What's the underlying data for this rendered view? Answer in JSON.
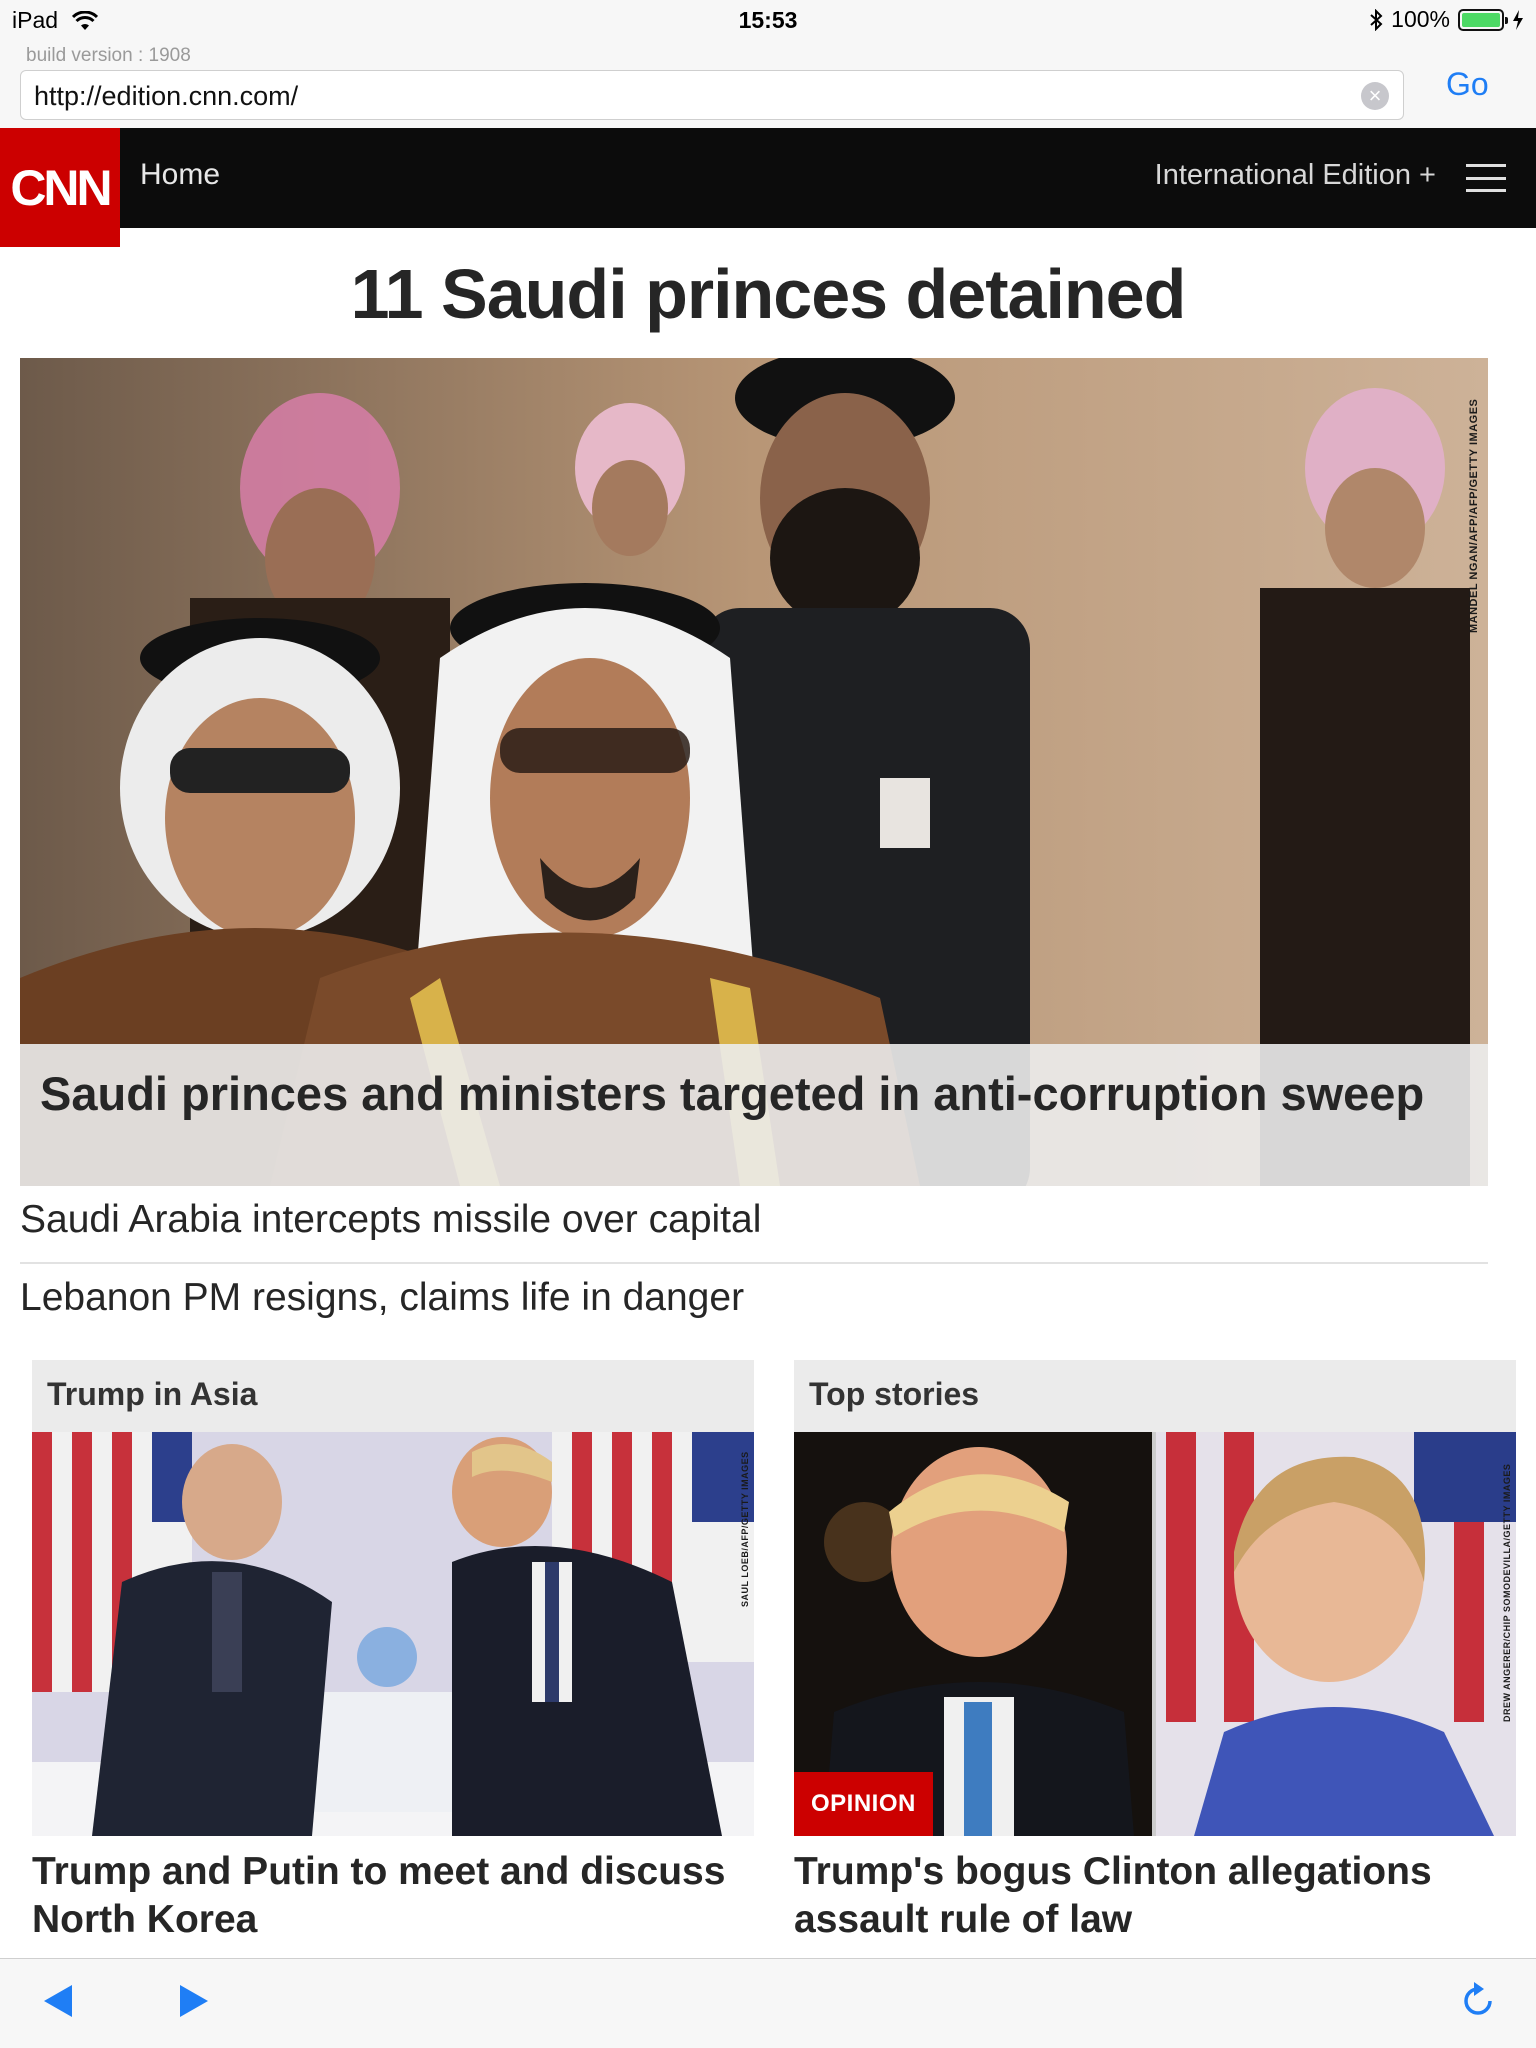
{
  "status_bar": {
    "device": "iPad",
    "time": "15:53",
    "battery": "100%"
  },
  "browser": {
    "build_label": "build version : 1908",
    "url": "http://edition.cnn.com/",
    "go_label": "Go",
    "back_icon": "back-arrow-icon",
    "forward_icon": "forward-arrow-icon",
    "reload_icon": "reload-icon"
  },
  "nav": {
    "logo": "CNN",
    "home": "Home",
    "edition": "International Edition +"
  },
  "headline": "11 Saudi princes detained",
  "hero": {
    "caption": "Saudi princes and ministers targeted in anti-corruption sweep",
    "credit": "MANDEL NGAN/AFP/AFP/GETTY IMAGES"
  },
  "links": [
    "Saudi Arabia intercepts missile over capital",
    "Lebanon PM resigns, claims life in danger"
  ],
  "zones": [
    {
      "title": "Trump in Asia",
      "story": "Trump and Putin to meet and discuss North Korea",
      "credit": "SAUL LOEB/AFP/GETTY IMAGES"
    },
    {
      "title": "Top stories",
      "story": "Trump's bogus Clinton allegations assault rule of law",
      "badge": "OPINION",
      "credit": "DREW ANGERER/CHIP SOMODEVILLA/GETTY IMAGES"
    }
  ],
  "colors": {
    "cnn_red": "#cc0000",
    "ios_blue": "#1f7ef5",
    "nav_black": "#0c0c0c"
  }
}
